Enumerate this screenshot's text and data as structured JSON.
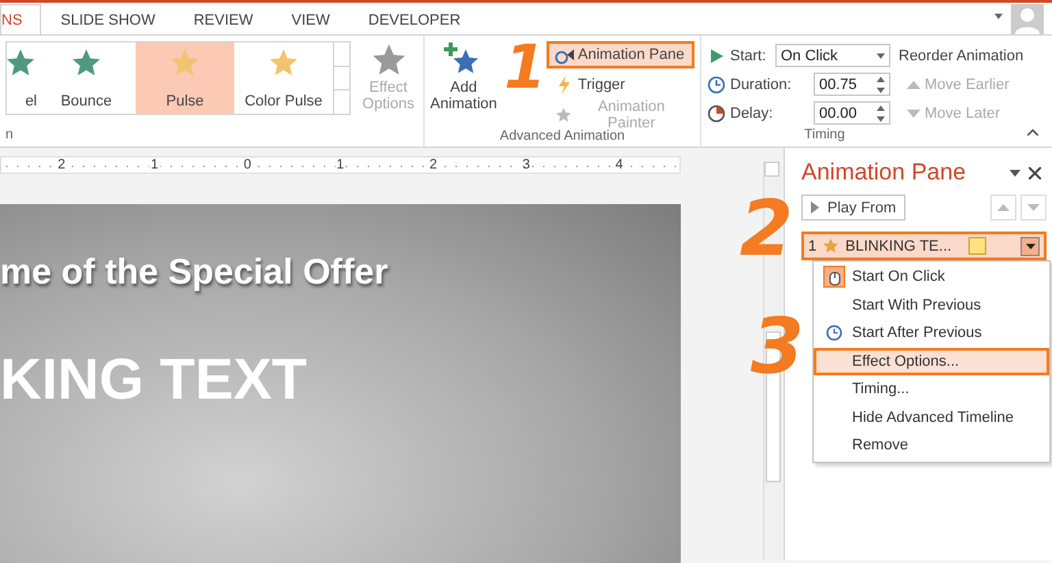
{
  "tabs": [
    {
      "label": "NS",
      "selected": true
    },
    {
      "label": "SLIDE SHOW",
      "selected": false
    },
    {
      "label": "REVIEW",
      "selected": false
    },
    {
      "label": "VIEW",
      "selected": false
    },
    {
      "label": "DEVELOPER",
      "selected": false
    }
  ],
  "animation_group": {
    "gallery": [
      {
        "label": "el",
        "selected": false
      },
      {
        "label": "Bounce",
        "selected": false
      },
      {
        "label": "Pulse",
        "selected": true
      },
      {
        "label": "Color Pulse",
        "selected": false
      }
    ],
    "effect_options": {
      "label": "Effect Options",
      "disabled": true
    },
    "group_label": "n"
  },
  "advanced_animation": {
    "add_animation": "Add Animation",
    "buttons": [
      {
        "label": "Animation Pane",
        "highlighted": true,
        "disabled": false
      },
      {
        "label": "Trigger",
        "highlighted": false,
        "disabled": false
      },
      {
        "label": "Animation Painter",
        "highlighted": false,
        "disabled": true
      }
    ],
    "group_label": "Advanced Animation"
  },
  "timing": {
    "start_label": "Start:",
    "start_value": "On Click",
    "duration_label": "Duration:",
    "duration_value": "00.75",
    "delay_label": "Delay:",
    "delay_value": "00.00",
    "reorder_title": "Reorder Animation",
    "move_earlier": {
      "label": "Move Earlier",
      "disabled": true
    },
    "move_later": {
      "label": "Move Later",
      "disabled": true
    },
    "group_label": "Timing"
  },
  "ruler": {
    "labels": [
      "2",
      "1",
      "0",
      "1",
      "2",
      "3",
      "4"
    ]
  },
  "slide": {
    "title": "me of the Special Offer",
    "heading": "KING TEXT"
  },
  "animation_pane": {
    "title": "Animation Pane",
    "play_from": "Play From",
    "item": {
      "number": "1",
      "name": "BLINKING TE...",
      "highlighted": true
    },
    "menu": [
      {
        "label": "Start On Click",
        "kind": "mouse",
        "checked": true,
        "highlighted": false
      },
      {
        "label": "Start With Previous",
        "kind": "plain",
        "checked": false,
        "highlighted": false
      },
      {
        "label": "Start After Previous",
        "kind": "clock",
        "checked": false,
        "highlighted": false
      },
      {
        "label": "Effect Options...",
        "kind": "plain",
        "checked": false,
        "highlighted": true
      },
      {
        "label": "Timing...",
        "kind": "plain",
        "checked": false,
        "highlighted": false
      },
      {
        "label": "Hide Advanced Timeline",
        "kind": "plain",
        "checked": false,
        "highlighted": false
      },
      {
        "label": "Remove",
        "kind": "plain",
        "checked": false,
        "highlighted": false
      }
    ]
  },
  "annotations": [
    "1",
    "2",
    "3"
  ]
}
